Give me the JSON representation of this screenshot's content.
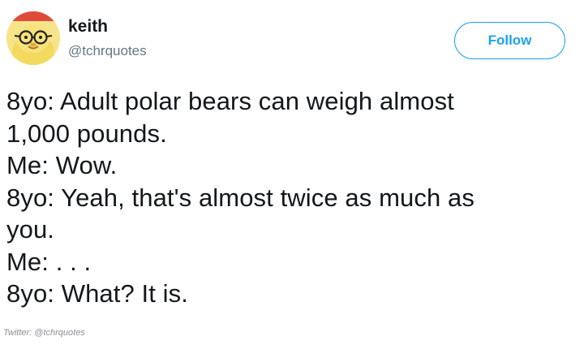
{
  "author": {
    "name": "keith",
    "handle": "@tchrquotes"
  },
  "follow_button": {
    "label": "Follow",
    "color": "#1da1f2"
  },
  "tweet": {
    "lines": [
      "8yo: Adult polar bears can weigh almost",
      "1,000 pounds.",
      "Me: Wow.",
      "8yo: Yeah, that's almost twice as much as",
      "you.",
      "Me: . . .",
      "8yo: What? It is."
    ]
  },
  "credit": "Twitter: @tchrquotes"
}
